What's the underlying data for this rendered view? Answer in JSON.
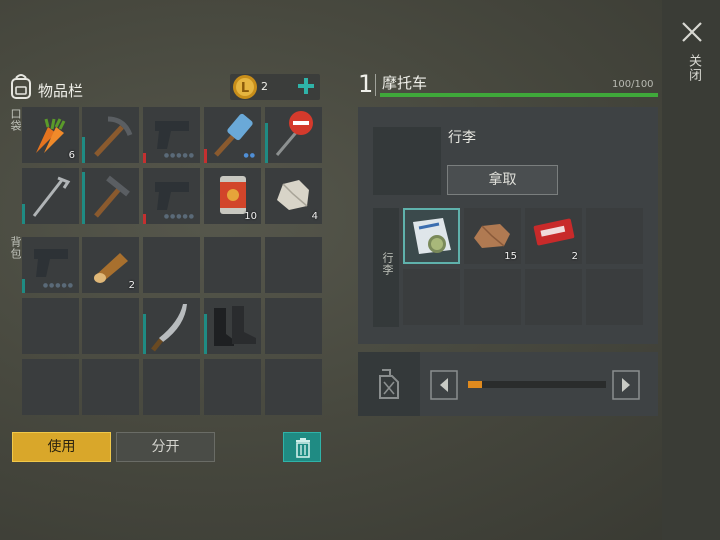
{
  "inventory": {
    "title": "物品栏",
    "coins": "2",
    "pocket_label": "口袋",
    "backpack_label": "背包",
    "pocket_slots": [
      {
        "item": "carrot",
        "qty": "6"
      },
      {
        "item": "pickaxe",
        "qty": ""
      },
      {
        "item": "pistol",
        "qty": ""
      },
      {
        "item": "hammer",
        "qty": ""
      },
      {
        "item": "stop-sign",
        "qty": ""
      },
      {
        "item": "hoe",
        "qty": ""
      },
      {
        "item": "pickaxe",
        "qty": ""
      },
      {
        "item": "pistol",
        "qty": ""
      },
      {
        "item": "canned-food",
        "qty": "10"
      },
      {
        "item": "stone",
        "qty": "4"
      }
    ],
    "backpack_slots": [
      {
        "item": "pistol",
        "qty": ""
      },
      {
        "item": "log",
        "qty": "2"
      },
      {
        "item": "",
        "qty": ""
      },
      {
        "item": "",
        "qty": ""
      },
      {
        "item": "",
        "qty": ""
      },
      {
        "item": "",
        "qty": ""
      },
      {
        "item": "",
        "qty": ""
      },
      {
        "item": "machete",
        "qty": ""
      },
      {
        "item": "boots",
        "qty": ""
      },
      {
        "item": "",
        "qty": ""
      },
      {
        "item": "",
        "qty": ""
      },
      {
        "item": "",
        "qty": ""
      },
      {
        "item": "",
        "qty": ""
      },
      {
        "item": "",
        "qty": ""
      },
      {
        "item": "",
        "qty": ""
      }
    ],
    "use_label": "使用",
    "split_label": "分开"
  },
  "vehicle": {
    "index": "1",
    "name": "摩托车",
    "capacity": "100/100",
    "durability_fraction": 1.0,
    "luggage_title": "行李",
    "take_label": "拿取",
    "storage_label": "行李",
    "storage_slots": [
      {
        "item": "map-scroll",
        "qty": ""
      },
      {
        "item": "ore",
        "qty": "15"
      },
      {
        "item": "coupon",
        "qty": "2"
      },
      {
        "item": "",
        "qty": ""
      },
      {
        "item": "",
        "qty": ""
      },
      {
        "item": "",
        "qty": ""
      },
      {
        "item": "",
        "qty": ""
      },
      {
        "item": "",
        "qty": ""
      }
    ],
    "fuel_fraction": 0.1
  },
  "close_label": "关闭",
  "colors": {
    "accent_yellow": "#d9a72a",
    "progress_green": "#3fa83a",
    "teal": "#1f8b83",
    "fuel_orange": "#e08a1e"
  }
}
